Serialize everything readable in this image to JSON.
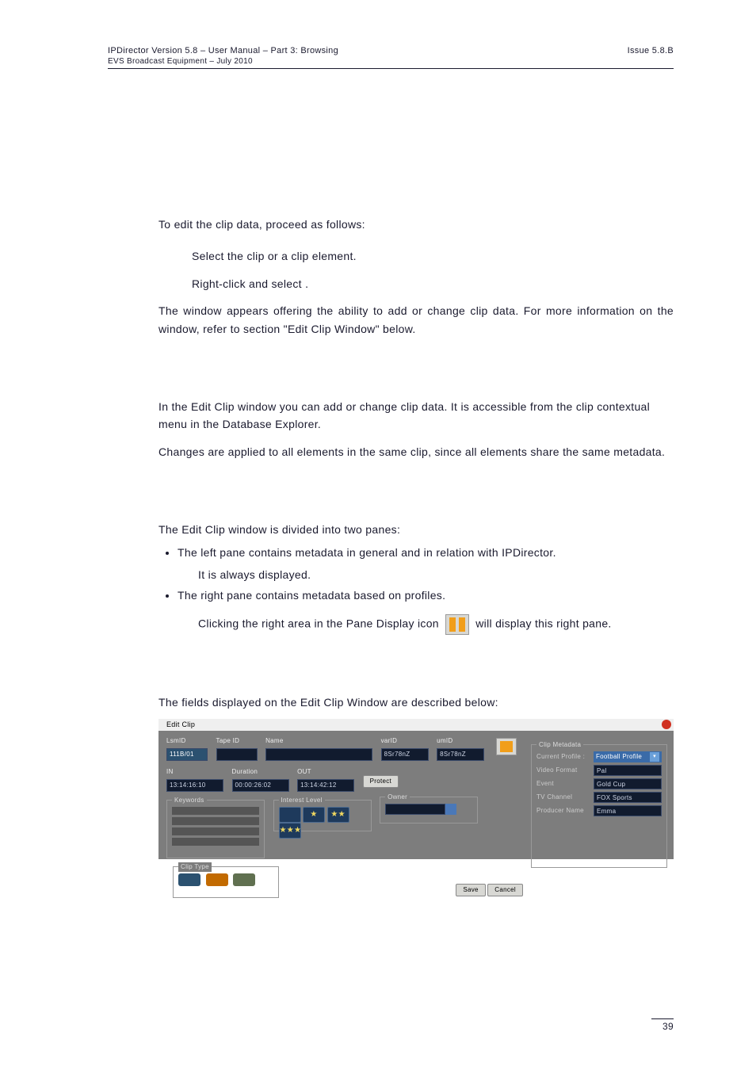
{
  "header": {
    "line1": "IPDirector Version 5.8 – User Manual – Part 3: Browsing",
    "line2": "EVS Broadcast Equipment – July 2010",
    "issue": "Issue 5.8.B"
  },
  "para1": "To edit the clip data, proceed as follows:",
  "step1": "Select the clip or a clip element.",
  "step2a": "Right-click and select ",
  "step2b": ".",
  "para2": "The  window appears offering the ability to add or change clip data. For more information on the  window, refer to section \"Edit Clip Window\" below.",
  "para3": "In the Edit Clip window you can add or change clip data. It is accessible from the clip contextual menu in the Database Explorer.",
  "para4": "Changes are applied to all elements in the same clip, since all elements share the same metadata.",
  "para5": "The Edit Clip window is divided into two panes:",
  "bullet1": "The left pane contains metadata in general and in relation with IPDirector.",
  "bullet1sub": "It is always displayed.",
  "bullet2": "The right pane contains metadata based on profiles.",
  "bullet2sub_a": "Clicking the right area in the Pane Display icon ",
  "bullet2sub_b": " will display this right pane.",
  "para6": "The fields displayed on the Edit Clip Window are described below:",
  "page": "39",
  "editclip": {
    "title": "Edit Clip",
    "lsmid_lbl": "LsmID",
    "lsmid": "111B/01",
    "tapeid_lbl": "Tape ID",
    "name_lbl": "Name",
    "varid_lbl": "varID",
    "varid": "8Sr78nZ",
    "umid_lbl": "umID",
    "umid": "8Sr78nZ",
    "in_lbl": "IN",
    "in": "13:14:16:10",
    "dur_lbl": "Duration",
    "dur": "00:00:26:02",
    "out_lbl": "OUT",
    "out": "13:14:42:12",
    "protect": "Protect",
    "kw_lbl": "Keywords",
    "int_lbl": "Interest Level",
    "owner_lbl": "Owner",
    "ct_lbl": "Clip Type",
    "save": "Save",
    "cancel": "Cancel",
    "md_lbl": "Clip Metadata",
    "md_profile_lbl": "Current Profile :",
    "md_profile": "Football Profile",
    "md_rows": [
      {
        "k": "Video Format",
        "v": "Pal"
      },
      {
        "k": "Event",
        "v": "Gold Cup"
      },
      {
        "k": "TV Channel",
        "v": "FOX Sports"
      },
      {
        "k": "Producer Name",
        "v": "Emma"
      }
    ]
  }
}
